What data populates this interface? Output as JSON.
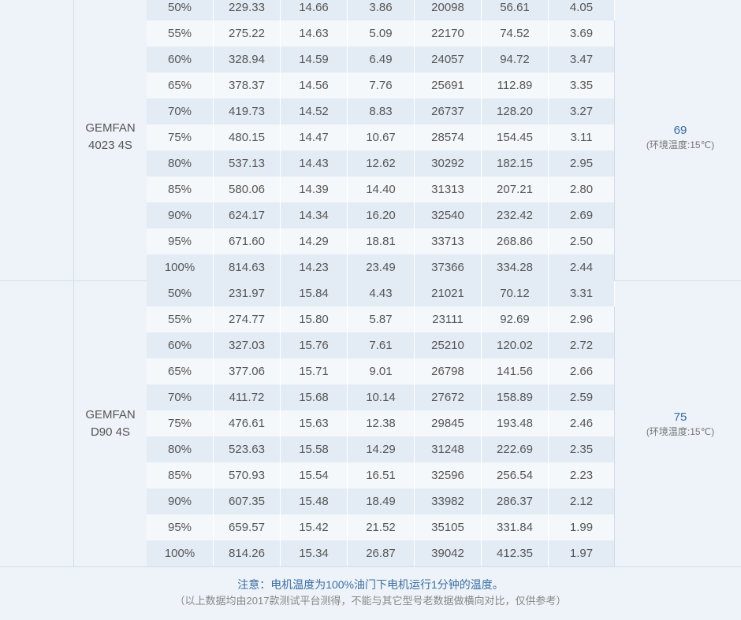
{
  "groups": [
    {
      "model_line1": "GEMFAN",
      "model_line2": "4023 4S",
      "temp_value": "69",
      "temp_note": "(环境温度:15℃)",
      "rows": [
        [
          "50%",
          "229.33",
          "14.66",
          "3.86",
          "20098",
          "56.61",
          "4.05"
        ],
        [
          "55%",
          "275.22",
          "14.63",
          "5.09",
          "22170",
          "74.52",
          "3.69"
        ],
        [
          "60%",
          "328.94",
          "14.59",
          "6.49",
          "24057",
          "94.72",
          "3.47"
        ],
        [
          "65%",
          "378.37",
          "14.56",
          "7.76",
          "25691",
          "112.89",
          "3.35"
        ],
        [
          "70%",
          "419.73",
          "14.52",
          "8.83",
          "26737",
          "128.20",
          "3.27"
        ],
        [
          "75%",
          "480.15",
          "14.47",
          "10.67",
          "28574",
          "154.45",
          "3.11"
        ],
        [
          "80%",
          "537.13",
          "14.43",
          "12.62",
          "30292",
          "182.15",
          "2.95"
        ],
        [
          "85%",
          "580.06",
          "14.39",
          "14.40",
          "31313",
          "207.21",
          "2.80"
        ],
        [
          "90%",
          "624.17",
          "14.34",
          "16.20",
          "32540",
          "232.42",
          "2.69"
        ],
        [
          "95%",
          "671.60",
          "14.29",
          "18.81",
          "33713",
          "268.86",
          "2.50"
        ],
        [
          "100%",
          "814.63",
          "14.23",
          "23.49",
          "37366",
          "334.28",
          "2.44"
        ]
      ]
    },
    {
      "model_line1": "GEMFAN",
      "model_line2": "D90 4S",
      "temp_value": "75",
      "temp_note": "(环境温度:15℃)",
      "rows": [
        [
          "50%",
          "231.97",
          "15.84",
          "4.43",
          "21021",
          "70.12",
          "3.31"
        ],
        [
          "55%",
          "274.77",
          "15.80",
          "5.87",
          "23111",
          "92.69",
          "2.96"
        ],
        [
          "60%",
          "327.03",
          "15.76",
          "7.61",
          "25210",
          "120.02",
          "2.72"
        ],
        [
          "65%",
          "377.06",
          "15.71",
          "9.01",
          "26798",
          "141.56",
          "2.66"
        ],
        [
          "70%",
          "411.72",
          "15.68",
          "10.14",
          "27672",
          "158.89",
          "2.59"
        ],
        [
          "75%",
          "476.61",
          "15.63",
          "12.38",
          "29845",
          "193.48",
          "2.46"
        ],
        [
          "80%",
          "523.63",
          "15.58",
          "14.29",
          "31248",
          "222.69",
          "2.35"
        ],
        [
          "85%",
          "570.93",
          "15.54",
          "16.51",
          "32596",
          "256.54",
          "2.23"
        ],
        [
          "90%",
          "607.35",
          "15.48",
          "18.49",
          "33982",
          "286.37",
          "2.12"
        ],
        [
          "95%",
          "659.57",
          "15.42",
          "21.52",
          "35105",
          "331.84",
          "1.99"
        ],
        [
          "100%",
          "814.26",
          "15.34",
          "26.87",
          "39042",
          "412.35",
          "1.97"
        ]
      ]
    }
  ],
  "footer": {
    "note_main": "注意：电机温度为100%油门下电机运行1分钟的温度。",
    "note_sub": "（以上数据均由2017款测试平台测得，不能与其它型号老数据做横向对比，仅供参考）"
  },
  "colors": {
    "accent": "#3a6ea5",
    "row_odd": "#e3ecf5",
    "row_even": "#f5f8fb",
    "background": "#edf3f8"
  }
}
